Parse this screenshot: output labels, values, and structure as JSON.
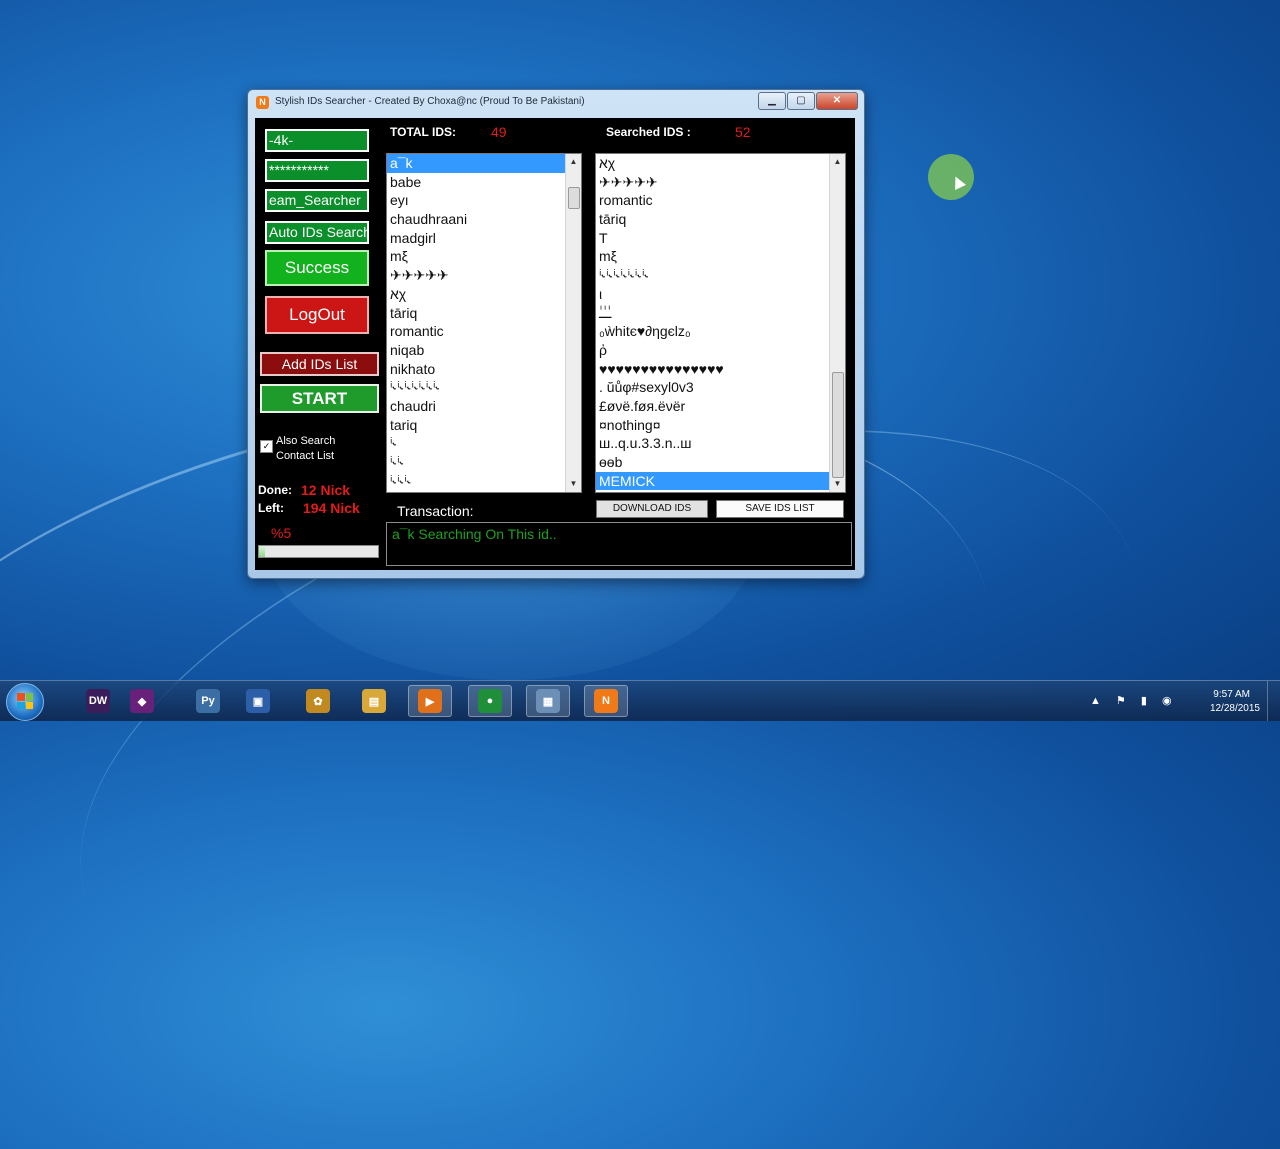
{
  "window": {
    "title": "Stylish IDs Searcher     -     Created By Choxa@nc (Proud To Be Pakistani)",
    "app_icon_letter": "N",
    "minimize": "▁",
    "maximize": "▢",
    "close": "✕"
  },
  "left_panel": {
    "field1_value": "-4k-",
    "field2_value": "***********",
    "field3_value": "eam_Searcher",
    "field4_value": "Auto IDs Search",
    "success_label": "Success",
    "logout_label": "LogOut",
    "add_ids_label": "Add IDs List",
    "start_label": "START",
    "checkbox_checked": "✓",
    "checkbox_label": "Also Search Contact List",
    "done_label": "Done:",
    "done_value": "12  Nick",
    "left_label": "Left:",
    "left_value": "194 Nick",
    "percent": "%5",
    "progress_fraction": 0.05
  },
  "totals": {
    "total_ids_label": "TOTAL IDS:",
    "total_ids_value": "49",
    "searched_ids_label": "Searched IDS :",
    "searched_ids_value": "52"
  },
  "list_ids": [
    {
      "text": "a¯k",
      "selected": true
    },
    {
      "text": "babe",
      "selected": false
    },
    {
      "text": "eyı",
      "selected": false
    },
    {
      "text": "chaudhraani",
      "selected": false
    },
    {
      "text": "madgirl",
      "selected": false
    },
    {
      "text": "mξ",
      "selected": false
    },
    {
      "text": "✈✈✈✈✈",
      "selected": false
    },
    {
      "text": "אχ",
      "selected": false
    },
    {
      "text": "tāriq",
      "selected": false
    },
    {
      "text": "romantic",
      "selected": false
    },
    {
      "text": "niqab",
      "selected": false
    },
    {
      "text": "nikhato",
      "selected": false
    },
    {
      "text": "ⁱ˞ⁱ˞ⁱ˞ⁱ˞ⁱ˞ⁱ˞ⁱ˞",
      "selected": false
    },
    {
      "text": "chaudri",
      "selected": false
    },
    {
      "text": "tariq",
      "selected": false
    },
    {
      "text": "ⁱ˞",
      "selected": false
    },
    {
      "text": "ⁱ˞ⁱ˞",
      "selected": false
    },
    {
      "text": "ⁱ˞ⁱ˞ⁱ˞",
      "selected": false
    }
  ],
  "list_searched": [
    {
      "text": "אχ",
      "selected": false
    },
    {
      "text": "✈✈✈✈✈",
      "selected": false
    },
    {
      "text": "romantic",
      "selected": false
    },
    {
      "text": "tāriq",
      "selected": false
    },
    {
      "text": "T",
      "selected": false
    },
    {
      "text": "mξ",
      "selected": false
    },
    {
      "text": "ⁱ˞ⁱ˞ⁱ˞ⁱ˞ⁱ˞ⁱ˞ⁱ˞",
      "selected": false
    },
    {
      "text": "ι",
      "selected": false
    },
    {
      "text": "ـٰـٰـٰ",
      "selected": false
    },
    {
      "text": "₀ẁhitє♥∂ηgєlz₀",
      "selected": false
    },
    {
      "text": "ῤ",
      "selected": false
    },
    {
      "text": "♥♥♥♥♥♥♥♥♥♥♥♥♥♥♥",
      "selected": false
    },
    {
      "text": ". ŭůφ#sexyl0v3",
      "selected": false
    },
    {
      "text": "£øνё.føя.ёνёr",
      "selected": false
    },
    {
      "text": "¤nothing¤",
      "selected": false
    },
    {
      "text": "ш..q.u.3.3.n..ш",
      "selected": false
    },
    {
      "text": "ɵɵb",
      "selected": false
    },
    {
      "text": "MEMICK",
      "selected": true
    }
  ],
  "actions": {
    "download_label": "DOWNLOAD IDS",
    "save_label": "SAVE IDS LIST"
  },
  "transaction": {
    "label": "Transaction:",
    "text": "a¯k Searching On This id.."
  },
  "taskbar": {
    "icons": [
      {
        "name": "dreamweaver",
        "glyph": "DW",
        "color": "#3a1e5c"
      },
      {
        "name": "visual-studio",
        "glyph": "◆",
        "color": "#68217a"
      },
      {
        "name": "python",
        "glyph": "Py",
        "color": "#3b6ea5"
      },
      {
        "name": "network",
        "glyph": "▣",
        "color": "#2d5fa8"
      },
      {
        "name": "party-app",
        "glyph": "✿",
        "color": "#c08a20"
      },
      {
        "name": "folder",
        "glyph": "▤",
        "color": "#d8a838"
      },
      {
        "name": "media-player",
        "glyph": "▶",
        "color": "#e0701a"
      },
      {
        "name": "chrome",
        "glyph": "●",
        "color": "#1f8f3a"
      },
      {
        "name": "image-viewer",
        "glyph": "▦",
        "color": "#6c8fb5"
      },
      {
        "name": "ids-searcher",
        "glyph": "N",
        "color": "#f07a18"
      }
    ],
    "tray_icons": "▲ ⚑ ▮ ◉",
    "clock_time": "9:57 AM",
    "clock_date": "12/28/2015"
  }
}
